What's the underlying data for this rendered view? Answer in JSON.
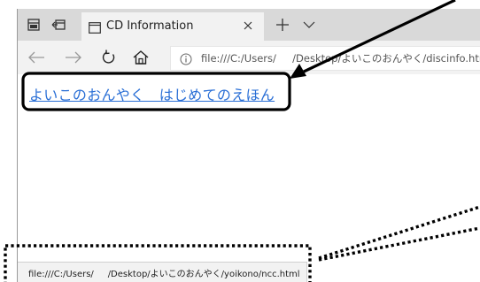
{
  "tab": {
    "title": "CD Information",
    "close_icon": "close-icon",
    "new_tab_icon": "plus-icon",
    "menu_icon": "chevron-down-icon"
  },
  "toolbar": {
    "tab_actions_icon": "tab-set-aside-icon",
    "back_icon": "back-arrow-icon",
    "forward_icon": "forward-arrow-icon",
    "refresh_icon": "refresh-icon",
    "home_icon": "home-icon"
  },
  "address": {
    "url": "file:///C:/Users/     /Desktop/よいこのおんやく/discinfo.html",
    "info_icon": "info-icon"
  },
  "page": {
    "link_text": "よいこのおんやく　はじめてのえほん"
  },
  "status": {
    "url": "file:///C:/Users/     /Desktop/よいこのおんやく/yoikono/ncc.html"
  },
  "annotations": {
    "solid_color": "#000000",
    "dotted_color": "#000000"
  }
}
